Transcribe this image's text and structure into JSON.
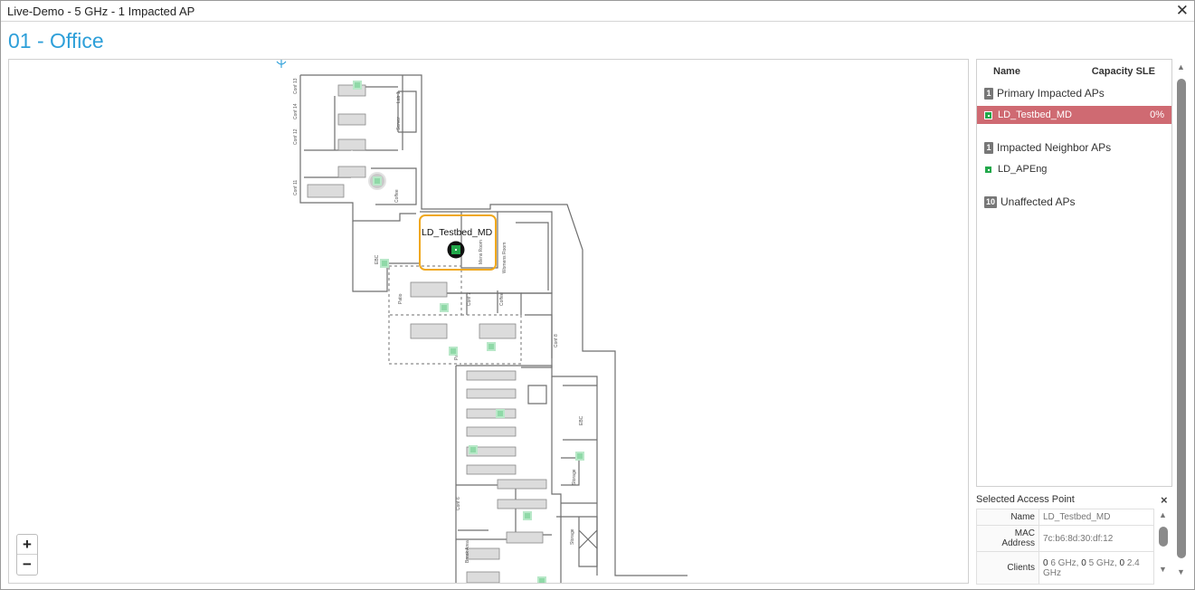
{
  "window": {
    "title": "Live-Demo - 5 GHz - 1 Impacted AP",
    "close_glyph": "✕"
  },
  "page": {
    "title": "01 - Office"
  },
  "map": {
    "zoom_in": "+",
    "zoom_out": "−",
    "ap_label": "LD_Testbed_MD",
    "room_labels": [
      "Lab 1",
      "Server",
      "Conf 13",
      "Conf 14",
      "Conf 12",
      "Conf 11",
      "EBC",
      "Coffee",
      "Patio",
      "Conf 7",
      "Coffee",
      "Conf 8",
      "Womens Room",
      "Mens Room",
      "Conf 6",
      "Break Area",
      "Storage",
      "EBC",
      "Storage",
      "Patio"
    ]
  },
  "ap_list": {
    "columns": {
      "name": "Name",
      "sle": "Capacity SLE"
    },
    "groups": [
      {
        "count": "1",
        "label": "Primary Impacted APs",
        "items": [
          {
            "name": "LD_Testbed_MD",
            "sle": "0%",
            "selected": true
          }
        ]
      },
      {
        "count": "1",
        "label": "Impacted Neighbor APs",
        "items": [
          {
            "name": "LD_APEng",
            "sle": "",
            "selected": false
          }
        ]
      },
      {
        "count": "10",
        "label": "Unaffected APs",
        "items": []
      }
    ]
  },
  "selected_ap": {
    "title": "Selected Access Point",
    "close_glyph": "×",
    "name_label": "Name",
    "name_value": "LD_Testbed_MD",
    "mac_label": "MAC Address",
    "mac_value": "7c:b6:8d:30:df:12",
    "clients_label": "Clients",
    "clients": {
      "c6": "0",
      "u6": " 6 GHz, ",
      "c5": "0",
      "u5": " 5 GHz, ",
      "c24": "0",
      "u24": " 2.4 GHz"
    }
  },
  "colors": {
    "accent": "#2d9fd9",
    "selected_row": "#cf6a72",
    "ap_green": "#22a84a",
    "highlight_box": "#f0a81c"
  },
  "icons": {
    "close": "close-icon",
    "ap": "access-point-icon",
    "scroll_up": "scroll-up-icon",
    "scroll_down": "scroll-down-icon",
    "compass": "compass-icon"
  }
}
